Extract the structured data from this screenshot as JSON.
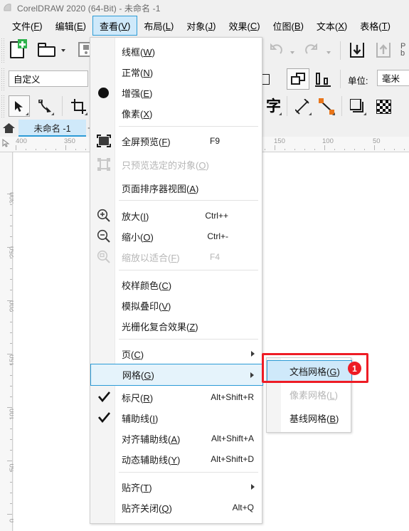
{
  "window": {
    "title": "CorelDRAW 2020 (64-Bit) - 未命名 -1",
    "logo_icon": "coreldraw-logo-icon"
  },
  "menubar": {
    "items": [
      {
        "label": "文件(F)",
        "active": false
      },
      {
        "label": "编辑(E)",
        "active": false
      },
      {
        "label": "查看(V)",
        "active": true
      },
      {
        "label": "布局(L)",
        "active": false
      },
      {
        "label": "对象(J)",
        "active": false
      },
      {
        "label": "效果(C)",
        "active": false
      },
      {
        "label": "位图(B)",
        "active": false
      },
      {
        "label": "文本(X)",
        "active": false
      },
      {
        "label": "表格(T)",
        "active": false
      }
    ]
  },
  "toolbar": {
    "preset_combo_value": "自定义",
    "units_label": "单位:",
    "units_value": "毫米",
    "icons": [
      "new-document-icon",
      "open-folder-icon",
      "save-icon",
      "undo-icon",
      "redo-icon",
      "import-icon",
      "export-icon",
      "pick-tool-icon",
      "shape-tool-icon",
      "crop-tool-icon",
      "text-tool-icon",
      "dimension-tool-icon",
      "connector-tool-icon",
      "shadow-tool-icon",
      "transparency-tool-icon"
    ]
  },
  "doctabs": {
    "home_icon": "home-icon",
    "tabs": [
      {
        "label": "未命名 -1",
        "active": true
      }
    ],
    "add_label": "+"
  },
  "rulers": {
    "horizontal_labels": [
      "400",
      "350",
      "150",
      "100",
      "50"
    ],
    "vertical_labels": [
      "300",
      "250",
      "200",
      "150",
      "100",
      "50",
      "0"
    ]
  },
  "view_menu": {
    "items": [
      {
        "label": "线框(W)",
        "key": "",
        "type": "normal",
        "icon": "",
        "disabled": false
      },
      {
        "label": "正常(N)",
        "key": "",
        "type": "normal",
        "icon": "",
        "disabled": false
      },
      {
        "label": "增强(E)",
        "key": "",
        "type": "radio",
        "icon": "filled-dot-icon",
        "disabled": false
      },
      {
        "label": "像素(X)",
        "key": "",
        "type": "normal",
        "icon": "",
        "disabled": false
      },
      {
        "label": "全屏预览(F)",
        "key": "F9",
        "type": "normal",
        "icon": "fullscreen-preview-icon",
        "disabled": false
      },
      {
        "label": "只预览选定的对象(O)",
        "key": "",
        "type": "normal",
        "icon": "preview-selected-icon",
        "disabled": true
      },
      {
        "label": "页面排序器视图(A)",
        "key": "",
        "type": "normal",
        "icon": "",
        "disabled": false
      },
      {
        "label": "放大(I)",
        "key": "Ctrl++",
        "type": "normal",
        "icon": "zoom-in-icon",
        "disabled": false
      },
      {
        "label": "缩小(O)",
        "key": "Ctrl+-",
        "type": "normal",
        "icon": "zoom-out-icon",
        "disabled": false
      },
      {
        "label": "缩放以适合(F)",
        "key": "F4",
        "type": "normal",
        "icon": "zoom-fit-icon",
        "disabled": true
      },
      {
        "label": "校样颜色(C)",
        "key": "",
        "type": "normal",
        "icon": "",
        "disabled": false
      },
      {
        "label": "模拟叠印(V)",
        "key": "",
        "type": "normal",
        "icon": "",
        "disabled": false
      },
      {
        "label": "光栅化复合效果(Z)",
        "key": "",
        "type": "normal",
        "icon": "",
        "disabled": false
      },
      {
        "label": "页(C)",
        "key": "",
        "type": "submenu",
        "icon": "",
        "disabled": false
      },
      {
        "label": "网格(G)",
        "key": "",
        "type": "submenu",
        "icon": "",
        "disabled": false,
        "highlighted": true
      },
      {
        "label": "标尺(R)",
        "key": "Alt+Shift+R",
        "type": "checked",
        "icon": "check-icon",
        "disabled": false
      },
      {
        "label": "辅助线(I)",
        "key": "",
        "type": "checked",
        "icon": "check-icon",
        "disabled": false
      },
      {
        "label": "对齐辅助线(A)",
        "key": "Alt+Shift+A",
        "type": "normal",
        "icon": "",
        "disabled": false
      },
      {
        "label": "动态辅助线(Y)",
        "key": "Alt+Shift+D",
        "type": "normal",
        "icon": "",
        "disabled": false
      },
      {
        "label": "贴齐(T)",
        "key": "",
        "type": "submenu",
        "icon": "",
        "disabled": false
      },
      {
        "label": "贴齐关闭(Q)",
        "key": "Alt+Q",
        "type": "normal",
        "icon": "",
        "disabled": false
      }
    ]
  },
  "grid_submenu": {
    "items": [
      {
        "label": "文档网格(G)",
        "disabled": false,
        "highlighted": true
      },
      {
        "label": "像素网格(L)",
        "disabled": true,
        "highlighted": false
      },
      {
        "label": "基线网格(B)",
        "disabled": false,
        "highlighted": false
      }
    ]
  },
  "annotation": {
    "badge_number": "1",
    "highlight_color": "#ee1c25"
  }
}
